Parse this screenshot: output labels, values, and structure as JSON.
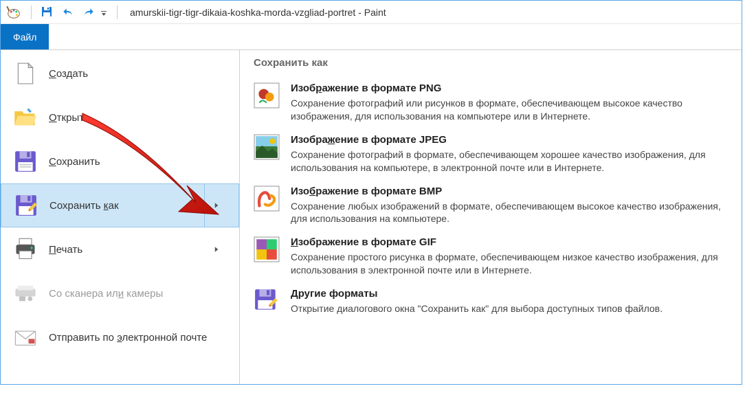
{
  "title": "amurskii-tigr-tigr-dikaia-koshka-morda-vzgliad-portret - Paint",
  "tabs": {
    "file": "Файл"
  },
  "menu": {
    "new": "Создать",
    "open": "Открыть",
    "save": "Сохранить",
    "save_as": "Сохранить как",
    "print": "Печать",
    "from_scanner": "Со сканера или камеры",
    "send_email": "Отправить по электронной почте"
  },
  "right": {
    "header": "Сохранить как",
    "png": {
      "title": "Изображение в формате PNG",
      "desc": "Сохранение фотографий или рисунков в формате, обеспечивающем высокое качество изображения, для использования на компьютере или в Интернете."
    },
    "jpeg": {
      "title": "Изображение в формате JPEG",
      "desc": "Сохранение фотографий в формате, обеспечивающем хорошее качество изображения, для использования на компьютере, в электронной почте или в Интернете."
    },
    "bmp": {
      "title": "Изображение в формате BMP",
      "desc": "Сохранение любых изображений в формате, обеспечивающем высокое качество изображения, для использования на компьютере."
    },
    "gif": {
      "title": "Изображение в формате GIF",
      "desc": "Сохранение простого рисунка в формате, обеспечивающем низкое качество изображения, для использования в электронной почте или в Интернете."
    },
    "other": {
      "title": "Другие форматы",
      "desc": "Открытие диалогового окна \"Сохранить как\" для выбора доступных типов файлов."
    }
  }
}
